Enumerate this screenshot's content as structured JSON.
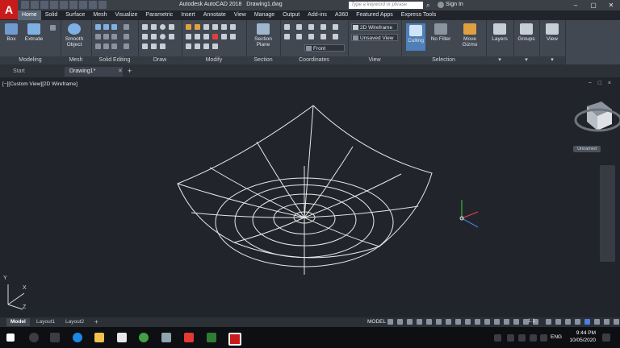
{
  "app": {
    "logo": "A",
    "title": "Autodesk AutoCAD 2018",
    "file": "Drawing1.dwg"
  },
  "search": {
    "placeholder": "Type a keyword or phrase"
  },
  "account": {
    "sign_in": "Sign In"
  },
  "ribbon_tabs": [
    "Home",
    "Solid",
    "Surface",
    "Mesh",
    "Visualize",
    "Parametric",
    "Insert",
    "Annotate",
    "View",
    "Manage",
    "Output",
    "Add-ins",
    "A360",
    "Featured Apps",
    "Express Tools"
  ],
  "ribbon": {
    "modeling": {
      "label": "Modeling",
      "box": "Box",
      "extrude": "Extrude"
    },
    "mesh": {
      "label": "Mesh",
      "smooth": "Smooth",
      "object": "Object"
    },
    "solid_editing": {
      "label": "Solid Editing"
    },
    "draw": {
      "label": "Draw"
    },
    "modify": {
      "label": "Modify"
    },
    "section": {
      "label": "Section",
      "plane1": "Section",
      "plane2": "Plane"
    },
    "coordinates": {
      "label": "Coordinates",
      "front": "Front"
    },
    "view": {
      "label": "View",
      "visual_style": "2D Wireframe",
      "saved_view": "Unsaved View"
    },
    "selection": {
      "label": "Selection",
      "culling": "Culling",
      "no_filter": "No Filter",
      "move": "Move",
      "gizmo": "Gizmo"
    },
    "layers": {
      "label": "Layers"
    },
    "groups": {
      "label": "Groups"
    },
    "view_btn": {
      "label": "View"
    }
  },
  "file_tabs": {
    "start": "Start",
    "drawing": "Drawing1*"
  },
  "viewport": {
    "label": "[−][Custom View][2D Wireframe]",
    "ctrl": "− □ ×",
    "viewcube": "Unnamed"
  },
  "ucs": {
    "x": "X",
    "y": "Y",
    "z": "Z"
  },
  "layout_tabs": [
    "Model",
    "Layout1",
    "Layout2"
  ],
  "status": {
    "model": "MODEL",
    "scale": "1:1"
  },
  "taskbar": {
    "lang": "ENG",
    "time": "9:44 PM",
    "date": "10/05/2020"
  },
  "colors": {
    "accent": "#5b6675",
    "app_red": "#c81b1b",
    "canvas": "#21252b"
  }
}
